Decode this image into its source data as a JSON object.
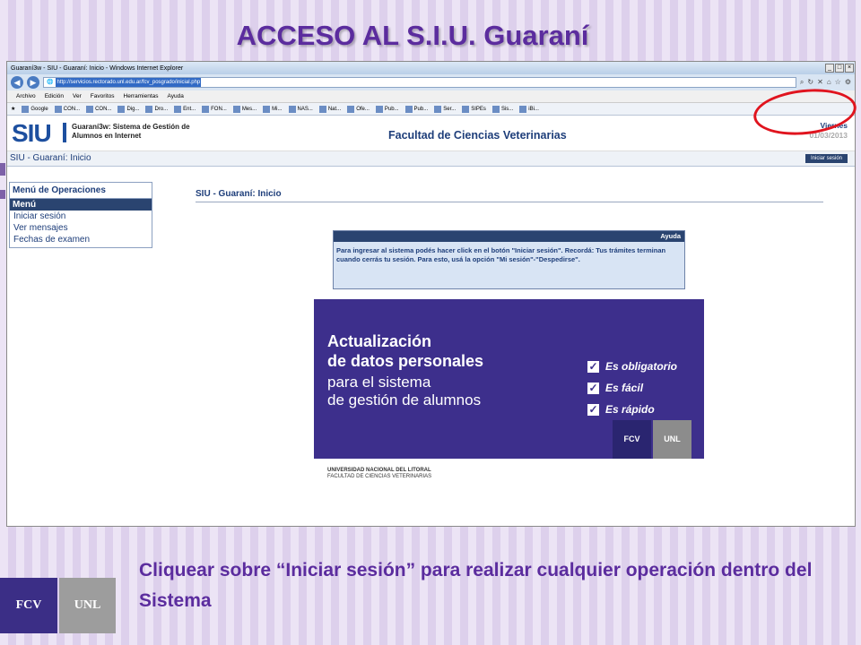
{
  "slide": {
    "title": "ACCESO AL S.I.U. Guaraní",
    "caption": "Cliquear sobre “Iniciar sesión” para realizar cualquier operación dentro del Sistema",
    "logo_fcv": "FCV",
    "logo_unl": "UNL"
  },
  "browser": {
    "window_title": "Guaraní3w - SIU - Guaraní: Inicio - Windows Internet Explorer",
    "url": "http://servicios.rectorado.unl.edu.ar/fcv_posgrado/inicial.php",
    "menu": [
      "Archivo",
      "Edición",
      "Ver",
      "Favoritos",
      "Herramientas",
      "Ayuda"
    ],
    "favorites": [
      "Google",
      "CON...",
      "CON...",
      "Dig...",
      "Dro...",
      "Ent...",
      "FON...",
      "Mes...",
      "Mi...",
      "NAS...",
      "Nat...",
      "Ofe...",
      "Pub...",
      "Pub...",
      "Ser...",
      "SIPEs",
      "Sis...",
      "iBi..."
    ]
  },
  "siu": {
    "logo": "SIU",
    "description": "Guaraní3w: Sistema de Gestión de Alumnos en Internet",
    "faculty": "Facultad de Ciencias Veterinarias",
    "day": "Viernes",
    "date": "01/03/2013",
    "page_bar": "SIU - Guaraní: Inicio",
    "login_button": "Iniciar sesión",
    "side_title": "Menú de Operaciones",
    "side_head": "Menú",
    "side_links": [
      "Iniciar sesión",
      "Ver mensajes",
      "Fechas de examen"
    ],
    "content_title": "SIU - Guaraní: Inicio",
    "help_head": "Ayuda",
    "help_text": "Para ingresar al sistema podés hacer click en el botón \"Iniciar sesión\". Recordá: Tus trámites terminan cuando cerrás tu sesión. Para esto, usá la opción \"Mi sesión\"-\"Despedirse\"."
  },
  "banner": {
    "line1": "Actualización",
    "line2": "de datos personales",
    "line3": "para el sistema",
    "line4": "de gestión de alumnos",
    "checks": [
      "Es obligatorio",
      "Es fácil",
      "Es rápido"
    ],
    "uni": "UNIVERSIDAD NACIONAL DEL LITORAL",
    "uni_sub": "FACULTAD DE CIENCIAS VETERINARIAS",
    "logo_fcv": "FCV",
    "logo_unl": "UNL"
  }
}
